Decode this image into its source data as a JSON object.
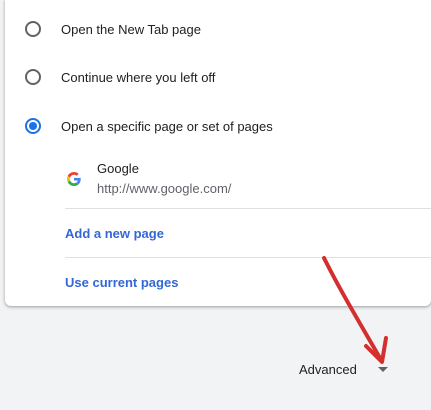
{
  "startup": {
    "options": [
      {
        "label": "Open the New Tab page",
        "checked": false
      },
      {
        "label": "Continue where you left off",
        "checked": false
      },
      {
        "label": "Open a specific page or set of pages",
        "checked": true
      }
    ],
    "pages": [
      {
        "name": "Google",
        "url": "http://www.google.com/",
        "favicon": "google-g-icon"
      }
    ],
    "add_page_label": "Add a new page",
    "use_current_label": "Use current pages"
  },
  "advanced": {
    "label": "Advanced",
    "icon": "caret-down-icon"
  },
  "colors": {
    "accent": "#1a73e8",
    "link": "#3367d6",
    "annotation_arrow": "#d32f2f"
  }
}
